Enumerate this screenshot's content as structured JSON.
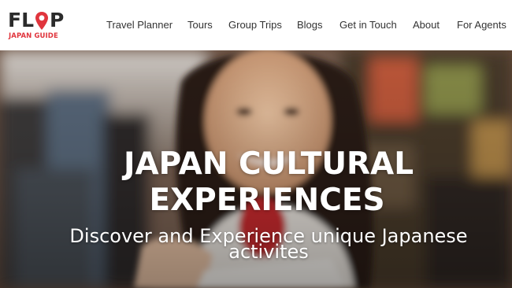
{
  "logo": {
    "left_text": "FL",
    "right_text": "P",
    "tagline": "JAPAN GUIDE"
  },
  "nav": {
    "items": [
      "Travel Planner",
      "Tours",
      "Group Trips",
      "Blogs",
      "Get in Touch",
      "About",
      "For Agents"
    ]
  },
  "hero": {
    "title_line1": "JAPAN CULTURAL",
    "title_line2": "EXPERIENCES",
    "subtitle_line1": "Discover and Experience unique Japanese",
    "subtitle_line2": "activites"
  },
  "colors": {
    "brand_red": "#e0353d",
    "text_dark": "#333333"
  }
}
